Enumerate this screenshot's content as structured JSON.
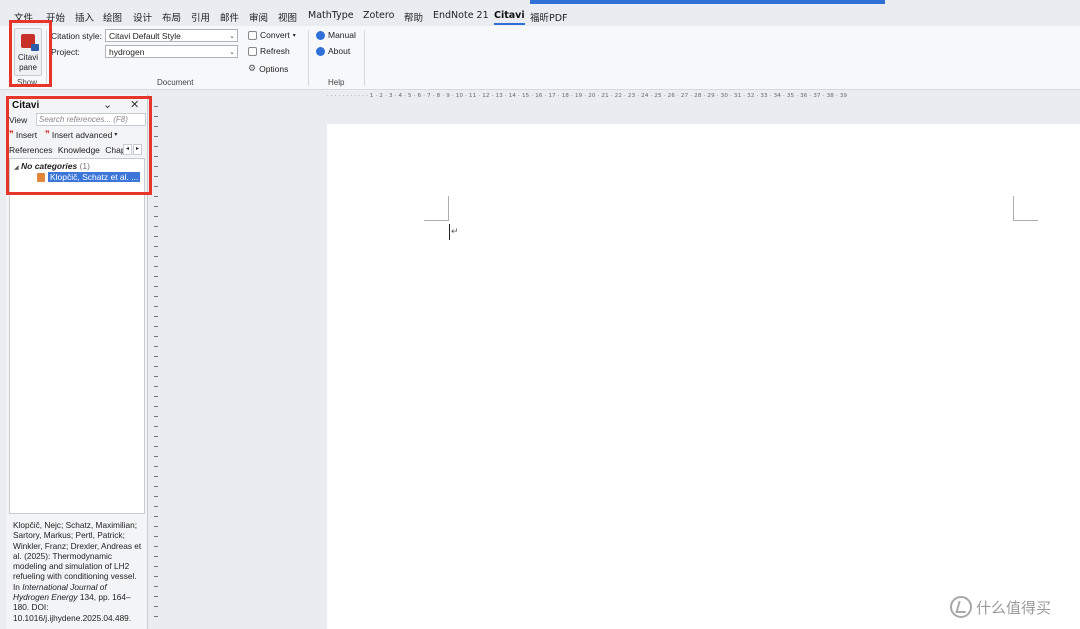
{
  "tabs": [
    "文件",
    "开始",
    "插入",
    "绘图",
    "设计",
    "布局",
    "引用",
    "邮件",
    "审阅",
    "视图",
    "MathType",
    "Zotero",
    "帮助",
    "EndNote 21",
    "Citavi",
    "福昕PDF"
  ],
  "active_tab": "Citavi",
  "ribbon": {
    "citavi_pane_label": "Citavi pane",
    "show_group": "Show",
    "citation_style_label": "Citation style:",
    "citation_style_value": "Citavi Default Style",
    "project_label": "Project:",
    "project_value": "hydrogen",
    "convert_label": "Convert",
    "refresh_label": "Refresh",
    "options_label": "Options",
    "document_group": "Document",
    "manual_label": "Manual",
    "about_label": "About",
    "help_group": "Help"
  },
  "pane": {
    "title": "Citavi",
    "view_label": "View",
    "search_placeholder": "Search references... (F8)",
    "insert_label": "Insert",
    "insert_advanced_label": "Insert advanced",
    "tab_references": "References",
    "tab_knowledge": "Knowledge",
    "tab_chapters": "Chapt",
    "category_name": "No categories",
    "category_count": "(1)",
    "selected_reference": "Klopčič, Schatz et al. ...",
    "citation_part1": "Klopčič, Nejc; Schatz, Maximilian; Sartory, Markus; Pertl, Patrick; Winkler, Franz; Drexler, Andreas et al. (2025): Thermodynamic modeling and simulation of LH2 refueling with conditioning vessel. In ",
    "citation_journal": "International Journal of Hydrogen Energy",
    "citation_part2": " 134, pp. 164–180. DOI: 10.1016/j.ijhydene.2025.04.489."
  },
  "ruler_text": "·  ·  ·  ·  ·  ·  ·  ·  ·  ·  ·  1  ·  2  ·  3  ·  4  ·  5  ·  6  ·  7  ·  8  ·  9  ·  10  ·  11  ·  12  ·  13  ·  14  ·  15  ·  16  ·  17  ·  18  ·  19  ·  20  ·  21  ·  22  ·  23  ·  24  ·  25  ·  26  ·  27  ·  28  ·  29  ·  30  ·  31  ·  32  ·  33  ·  34  ·  35  ·  36  ·  37  ·  38  ·  39",
  "pilcrow": "↵",
  "watermark": "什么值得买",
  "colors": {
    "accent": "#2f6fd6",
    "highlight_box": "#e8352b",
    "selection": "#3b76d8"
  }
}
